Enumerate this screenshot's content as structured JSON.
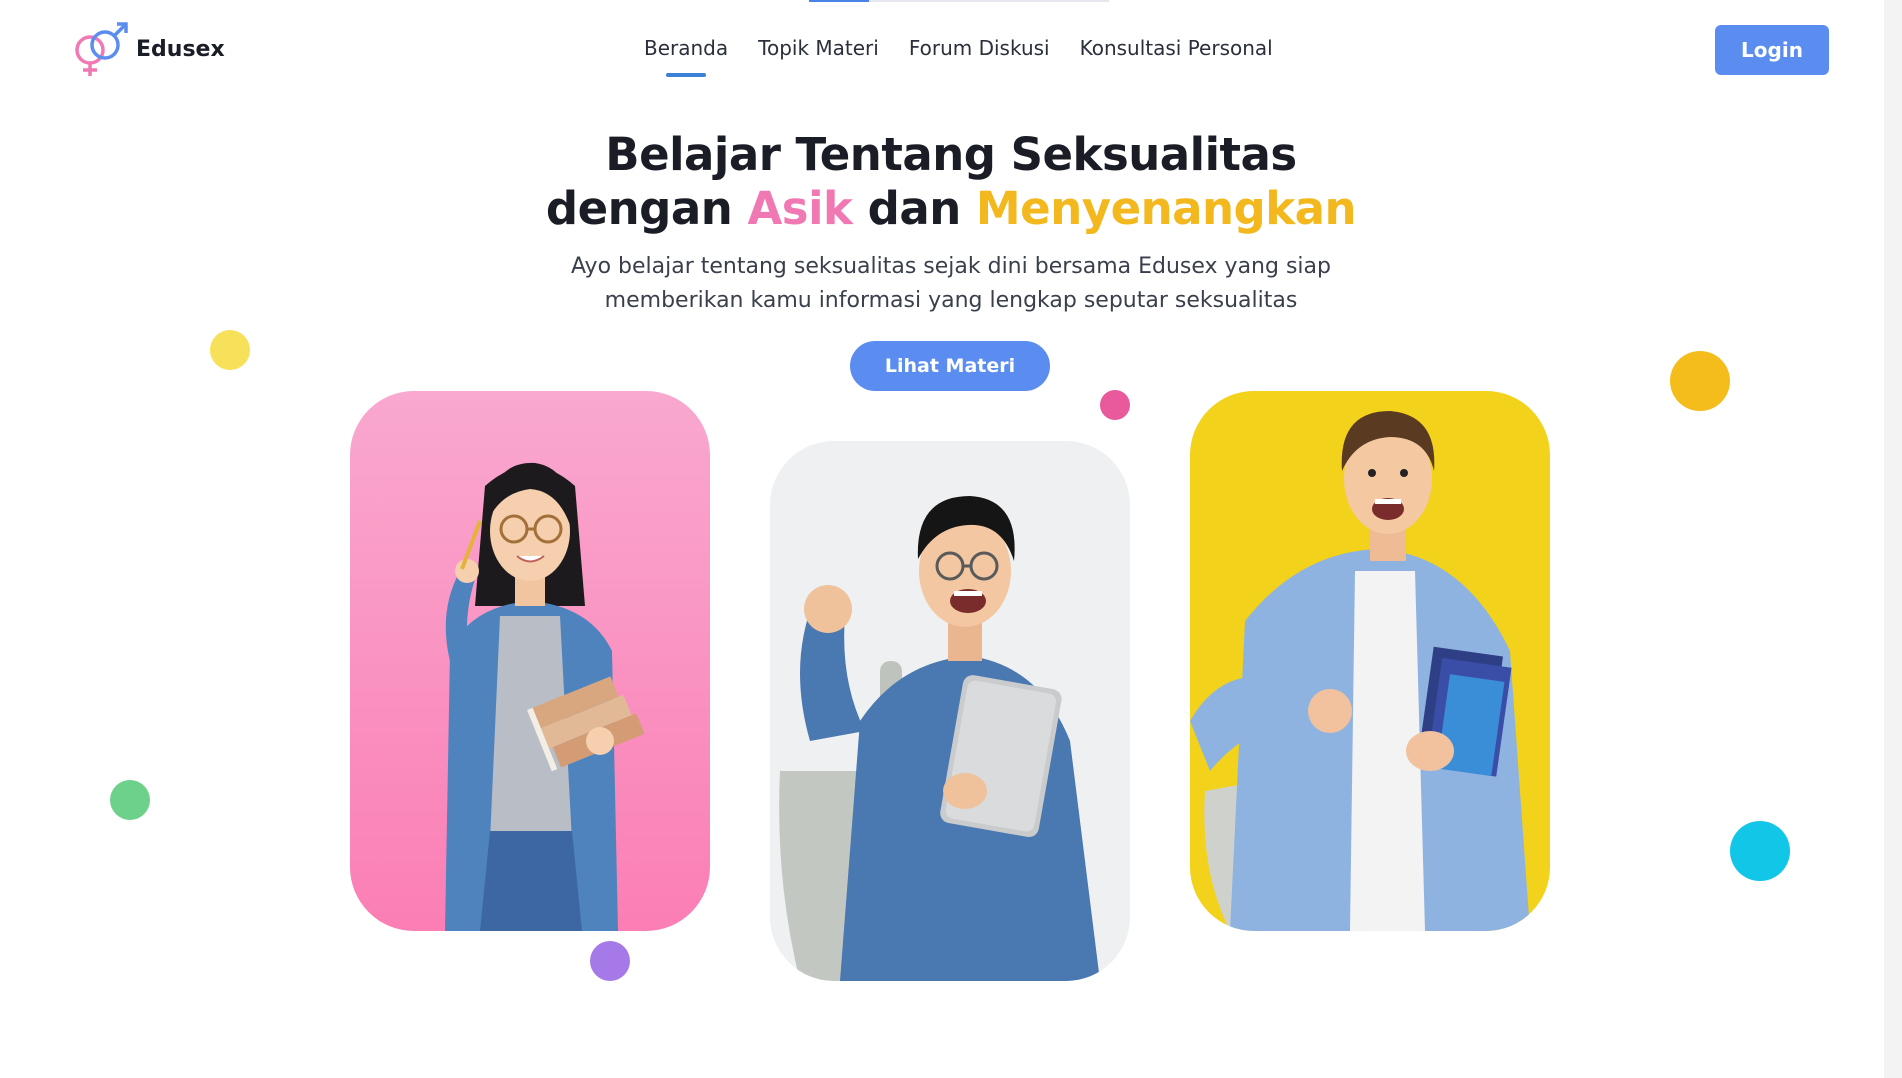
{
  "header": {
    "logo_text": "Edusex",
    "logo_icon": "gender-symbols-icon",
    "nav": [
      {
        "label": "Beranda",
        "active": true
      },
      {
        "label": "Topik Materi",
        "active": false
      },
      {
        "label": "Forum Diskusi",
        "active": false
      },
      {
        "label": "Konsultasi Personal",
        "active": false
      }
    ],
    "login_label": "Login"
  },
  "hero": {
    "title_line1": "Belajar Tentang Seksualitas",
    "title_line2_part1": "dengan",
    "title_line2_accent1": "Asik",
    "title_line2_part2": "dan",
    "title_line2_accent2": "Menyenangkan",
    "subtitle_line1": "Ayo belajar tentang seksualitas sejak dini bersama Edusex yang siap",
    "subtitle_line2": "memberikan kamu informasi yang lengkap seputar seksualitas",
    "cta_label": "Lihat Materi"
  },
  "cards": [
    {
      "name": "student-girl-pink",
      "background": "#f79cc8"
    },
    {
      "name": "student-boy-gray",
      "background": "#eef0f2"
    },
    {
      "name": "student-man-yellow",
      "background": "#f2d21a"
    }
  ],
  "colors": {
    "primary": "#5b8df0",
    "accent_pink": "#f079b4",
    "accent_yellow": "#f2b81e",
    "dot_yellow_light": "#f7e05a",
    "dot_pink": "#e85a9c",
    "dot_orange": "#f4bd1c",
    "dot_green": "#6dd18c",
    "dot_purple": "#a57ae8",
    "dot_cyan": "#12c6e8"
  }
}
